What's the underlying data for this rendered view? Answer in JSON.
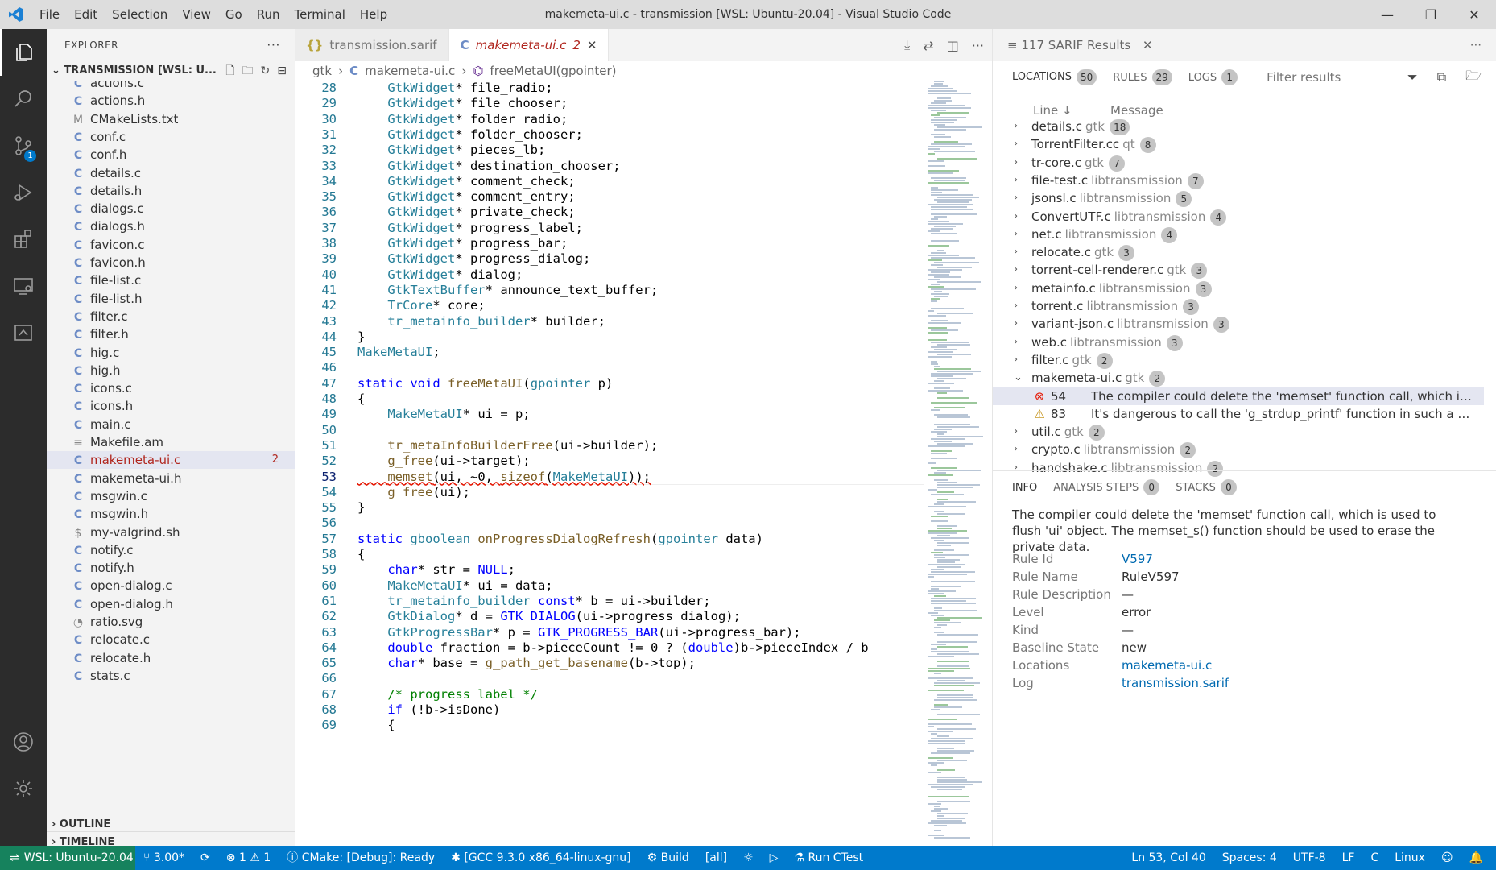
{
  "window": {
    "title": "makemeta-ui.c - transmission [WSL: Ubuntu-20.04] - Visual Studio Code",
    "menu": [
      "File",
      "Edit",
      "Selection",
      "View",
      "Go",
      "Run",
      "Terminal",
      "Help"
    ]
  },
  "activity": {
    "scm_badge": "1"
  },
  "sidebar": {
    "header": "EXPLORER",
    "workspace": "TRANSMISSION [WSL: U...",
    "outline": "OUTLINE",
    "timeline": "TIMELINE",
    "files": [
      {
        "icon": "C",
        "name": "actions.c"
      },
      {
        "icon": "C",
        "name": "actions.h"
      },
      {
        "icon": "M",
        "name": "CMakeLists.txt"
      },
      {
        "icon": "C",
        "name": "conf.c"
      },
      {
        "icon": "C",
        "name": "conf.h"
      },
      {
        "icon": "C",
        "name": "details.c"
      },
      {
        "icon": "C",
        "name": "details.h"
      },
      {
        "icon": "C",
        "name": "dialogs.c"
      },
      {
        "icon": "C",
        "name": "dialogs.h"
      },
      {
        "icon": "C",
        "name": "favicon.c"
      },
      {
        "icon": "C",
        "name": "favicon.h"
      },
      {
        "icon": "C",
        "name": "file-list.c"
      },
      {
        "icon": "C",
        "name": "file-list.h"
      },
      {
        "icon": "C",
        "name": "filter.c"
      },
      {
        "icon": "C",
        "name": "filter.h"
      },
      {
        "icon": "C",
        "name": "hig.c"
      },
      {
        "icon": "C",
        "name": "hig.h"
      },
      {
        "icon": "C",
        "name": "icons.c"
      },
      {
        "icon": "C",
        "name": "icons.h"
      },
      {
        "icon": "C",
        "name": "main.c"
      },
      {
        "icon": "≡",
        "name": "Makefile.am"
      },
      {
        "icon": "C",
        "name": "makemeta-ui.c",
        "count": "2"
      },
      {
        "icon": "C",
        "name": "makemeta-ui.h"
      },
      {
        "icon": "C",
        "name": "msgwin.c"
      },
      {
        "icon": "C",
        "name": "msgwin.h"
      },
      {
        "icon": "$",
        "name": "my-valgrind.sh"
      },
      {
        "icon": "C",
        "name": "notify.c"
      },
      {
        "icon": "C",
        "name": "notify.h"
      },
      {
        "icon": "C",
        "name": "open-dialog.c"
      },
      {
        "icon": "C",
        "name": "open-dialog.h"
      },
      {
        "icon": "◔",
        "name": "ratio.svg"
      },
      {
        "icon": "C",
        "name": "relocate.c"
      },
      {
        "icon": "C",
        "name": "relocate.h"
      },
      {
        "icon": "C",
        "name": "stats.c"
      }
    ]
  },
  "editor": {
    "tabs": [
      {
        "icon": "{}",
        "label": "transmission.sarif"
      },
      {
        "icon": "C",
        "label": "makemeta-ui.c",
        "badge": "2"
      }
    ],
    "breadcrumb": [
      "gtk",
      "makemeta-ui.c",
      "freeMetaUI(gpointer)"
    ],
    "lines": [
      {
        "n": "28",
        "t": "    GtkWidget* file_radio;"
      },
      {
        "n": "29",
        "t": "    GtkWidget* file_chooser;"
      },
      {
        "n": "30",
        "t": "    GtkWidget* folder_radio;"
      },
      {
        "n": "31",
        "t": "    GtkWidget* folder_chooser;"
      },
      {
        "n": "32",
        "t": "    GtkWidget* pieces_lb;"
      },
      {
        "n": "33",
        "t": "    GtkWidget* destination_chooser;"
      },
      {
        "n": "34",
        "t": "    GtkWidget* comment_check;"
      },
      {
        "n": "35",
        "t": "    GtkWidget* comment_entry;"
      },
      {
        "n": "36",
        "t": "    GtkWidget* private_check;"
      },
      {
        "n": "37",
        "t": "    GtkWidget* progress_label;"
      },
      {
        "n": "38",
        "t": "    GtkWidget* progress_bar;"
      },
      {
        "n": "39",
        "t": "    GtkWidget* progress_dialog;"
      },
      {
        "n": "40",
        "t": "    GtkWidget* dialog;"
      },
      {
        "n": "41",
        "t": "    GtkTextBuffer* announce_text_buffer;"
      },
      {
        "n": "42",
        "t": "    TrCore* core;"
      },
      {
        "n": "43",
        "t": "    tr_metainfo_builder* builder;"
      },
      {
        "n": "44",
        "t": "}"
      },
      {
        "n": "45",
        "t": "MakeMetaUI;"
      },
      {
        "n": "46",
        "t": ""
      },
      {
        "n": "47",
        "t": "static void freeMetaUI(gpointer p)"
      },
      {
        "n": "48",
        "t": "{"
      },
      {
        "n": "49",
        "t": "    MakeMetaUI* ui = p;"
      },
      {
        "n": "50",
        "t": ""
      },
      {
        "n": "51",
        "t": "    tr_metaInfoBuilderFree(ui->builder);"
      },
      {
        "n": "52",
        "t": "    g_free(ui->target);"
      },
      {
        "n": "53",
        "t": "    memset(ui, ~0, sizeof(MakeMetaUI));"
      },
      {
        "n": "54",
        "t": "    g_free(ui);"
      },
      {
        "n": "55",
        "t": "}"
      },
      {
        "n": "56",
        "t": ""
      },
      {
        "n": "57",
        "t": "static gboolean onProgressDialogRefresh(gpointer data)"
      },
      {
        "n": "58",
        "t": "{"
      },
      {
        "n": "59",
        "t": "    char* str = NULL;"
      },
      {
        "n": "60",
        "t": "    MakeMetaUI* ui = data;"
      },
      {
        "n": "61",
        "t": "    tr_metainfo_builder const* b = ui->builder;"
      },
      {
        "n": "62",
        "t": "    GtkDialog* d = GTK_DIALOG(ui->progress_dialog);"
      },
      {
        "n": "63",
        "t": "    GtkProgressBar* p = GTK_PROGRESS_BAR(ui->progress_bar);"
      },
      {
        "n": "64",
        "t": "    double fraction = b->pieceCount != 0 ? (double)b->pieceIndex / b"
      },
      {
        "n": "65",
        "t": "    char* base = g_path_get_basename(b->top);"
      },
      {
        "n": "66",
        "t": ""
      },
      {
        "n": "67",
        "t": "    /* progress label */"
      },
      {
        "n": "68",
        "t": "    if (!b->isDone)"
      },
      {
        "n": "69",
        "t": "    {"
      }
    ]
  },
  "sarif": {
    "title": "117 SARIF Results",
    "tabs": [
      {
        "label": "LOCATIONS",
        "count": "50"
      },
      {
        "label": "RULES",
        "count": "29"
      },
      {
        "label": "LOGS",
        "count": "1"
      }
    ],
    "filter_placeholder": "Filter results",
    "col_line": "Line",
    "col_message": "Message",
    "locations": [
      {
        "file": "details.c",
        "project": "gtk",
        "count": "18"
      },
      {
        "file": "TorrentFilter.cc",
        "project": "qt",
        "count": "8"
      },
      {
        "file": "tr-core.c",
        "project": "gtk",
        "count": "7"
      },
      {
        "file": "file-test.c",
        "project": "libtransmission",
        "count": "7"
      },
      {
        "file": "jsonsl.c",
        "project": "libtransmission",
        "count": "5"
      },
      {
        "file": "ConvertUTF.c",
        "project": "libtransmission",
        "count": "4"
      },
      {
        "file": "net.c",
        "project": "libtransmission",
        "count": "4"
      },
      {
        "file": "relocate.c",
        "project": "gtk",
        "count": "3"
      },
      {
        "file": "torrent-cell-renderer.c",
        "project": "gtk",
        "count": "3"
      },
      {
        "file": "metainfo.c",
        "project": "libtransmission",
        "count": "3"
      },
      {
        "file": "torrent.c",
        "project": "libtransmission",
        "count": "3"
      },
      {
        "file": "variant-json.c",
        "project": "libtransmission",
        "count": "3"
      },
      {
        "file": "web.c",
        "project": "libtransmission",
        "count": "3"
      },
      {
        "file": "filter.c",
        "project": "gtk",
        "count": "2"
      },
      {
        "file": "makemeta-ui.c",
        "project": "gtk",
        "count": "2",
        "expanded": true
      },
      {
        "file": "util.c",
        "project": "gtk",
        "count": "2"
      },
      {
        "file": "crypto.c",
        "project": "libtransmission",
        "count": "2"
      },
      {
        "file": "handshake.c",
        "project": "libtransmission",
        "count": "2"
      }
    ],
    "results": [
      {
        "line": "54",
        "message": "The compiler could delete the 'memset' function call, which is used ...",
        "kind": "error"
      },
      {
        "line": "83",
        "message": "It's dangerous to call the 'g_strdup_printf' function in such a manne...",
        "kind": "warning"
      }
    ],
    "info": {
      "tabs": [
        {
          "label": "INFO"
        },
        {
          "label": "ANALYSIS STEPS",
          "count": "0"
        },
        {
          "label": "STACKS",
          "count": "0"
        }
      ],
      "message": "The compiler could delete the 'memset' function call, which is used to flush 'ui' object. The memset_s() function should be used to erase the private data.",
      "fields": [
        {
          "k": "Rule Id",
          "v": "V597",
          "link": true
        },
        {
          "k": "Rule Name",
          "v": "RuleV597"
        },
        {
          "k": "Rule Description",
          "v": "—"
        },
        {
          "k": "Level",
          "v": "error"
        },
        {
          "k": "Kind",
          "v": "—"
        },
        {
          "k": "Baseline State",
          "v": "new"
        },
        {
          "k": "Locations",
          "v": "makemeta-ui.c",
          "link": true
        },
        {
          "k": "Log",
          "v": "transmission.sarif",
          "link": true
        }
      ]
    }
  },
  "status": {
    "remote": "WSL: Ubuntu-20.04",
    "branch": "3.00*",
    "problems": "1",
    "warnings": "1",
    "cmake": "CMake: [Debug]: Ready",
    "kit": "[GCC 9.3.0 x86_64-linux-gnu]",
    "build": "Build",
    "target": "[all]",
    "ctest": "Run CTest",
    "position": "Ln 53, Col 40",
    "spaces": "Spaces: 4",
    "encoding": "UTF-8",
    "eol": "LF",
    "language": "C",
    "os": "Linux"
  },
  "colors": {
    "accent": "#007acc",
    "remote": "#16825d",
    "error": "#e51400",
    "warning": "#bf8803"
  }
}
